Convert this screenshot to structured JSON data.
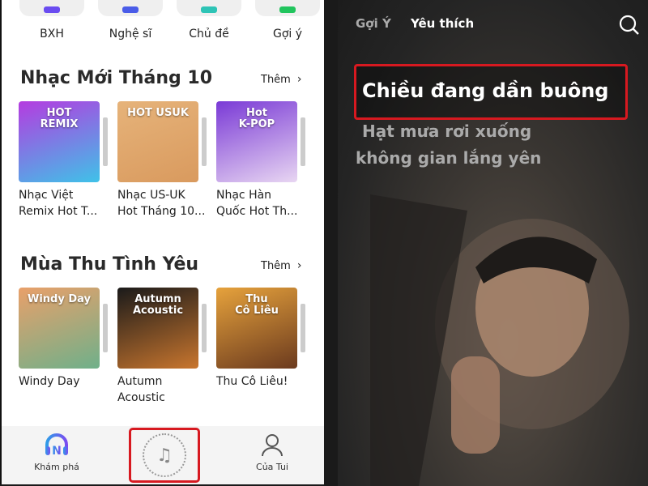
{
  "categories": [
    {
      "label": "BXH",
      "color": "#6a4cf0"
    },
    {
      "label": "Nghệ sĩ",
      "color": "#4a5ce8"
    },
    {
      "label": "Chủ đề",
      "color": "#2ec4b6"
    },
    {
      "label": "Gợi ý",
      "color": "#22c55e"
    }
  ],
  "sections": [
    {
      "title": "Nhạc Mới Tháng 10",
      "more": "Thêm",
      "chevron": "›",
      "cards": [
        {
          "title": "Nhạc Việt\nRemix Hot T...",
          "cover_text": "HOT\nREMIX",
          "colors": [
            "#b53be0",
            "#3fc2e8"
          ]
        },
        {
          "title": "Nhạc US-UK\nHot Tháng 10...",
          "cover_text": "HOT USUK",
          "colors": [
            "#e6b37a",
            "#d99a5e"
          ]
        },
        {
          "title": "Nhạc Hàn\nQuốc Hot Th...",
          "cover_text": "Hot\nK-POP",
          "colors": [
            "#7a3ad6",
            "#e8d6f2"
          ]
        }
      ]
    },
    {
      "title": "Mùa Thu Tình Yêu",
      "more": "Thêm",
      "chevron": "›",
      "cards": [
        {
          "title": "Windy Day",
          "cover_text": "Windy Day",
          "colors": [
            "#e9a06a",
            "#6fb08a"
          ]
        },
        {
          "title": "Autumn\nAcoustic",
          "cover_text": "Autumn\nAcoustic",
          "colors": [
            "#1a1a1a",
            "#c9762e"
          ]
        },
        {
          "title": "Thu Cô Liêu!",
          "cover_text": "Thu\nCô Liêu",
          "colors": [
            "#e6a23c",
            "#6b3a1e"
          ]
        }
      ]
    }
  ],
  "nav": {
    "discover": "Khám phá",
    "mine": "Của Tui",
    "center_icon": "music-note-icon"
  },
  "right": {
    "tabs": [
      "Gợi Ý",
      "Yêu thích"
    ],
    "active_tab": 1,
    "lyrics": [
      "Chiều đang dần buông",
      "Hạt mưa rơi xuống",
      "không gian lắng yên"
    ]
  },
  "colors": {
    "highlight": "#d71920"
  }
}
